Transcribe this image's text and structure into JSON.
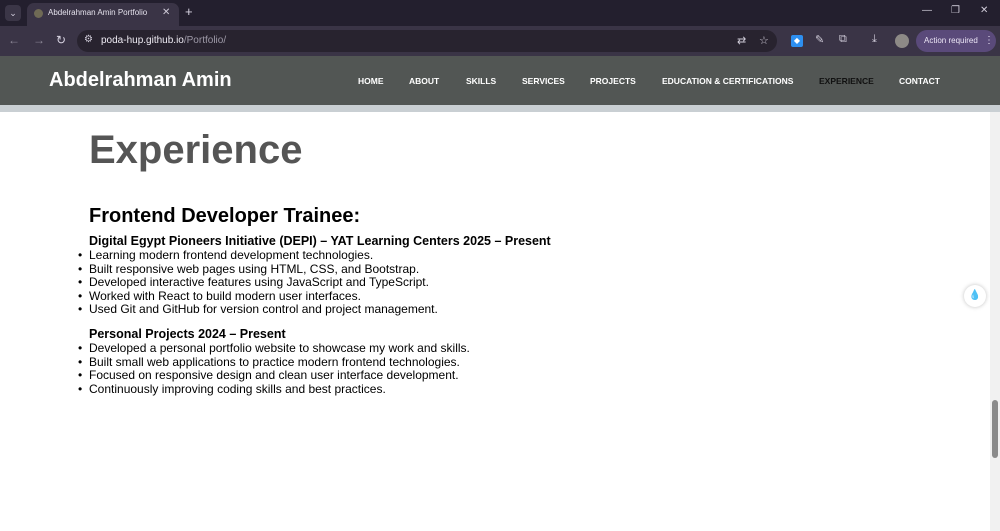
{
  "browser": {
    "tab_title": "Abdelrahman Amin Portfolio",
    "new_tab_icon": "plus-icon",
    "url_host": "poda-hup.github.io",
    "url_path": "/Portfolio/",
    "action_required": "Action required"
  },
  "site": {
    "brand": "Abdelrahman Amin",
    "nav": [
      "HOME",
      "ABOUT",
      "SKILLS",
      "SERVICES",
      "PROJECTS",
      "EDUCATION & CERTIFICATIONS",
      "EXPERIENCE",
      "CONTACT"
    ],
    "active_nav": "EXPERIENCE"
  },
  "content": {
    "section_title": "Experience",
    "job_title": "Frontend Developer Trainee:",
    "groups": [
      {
        "heading": "Digital Egypt Pioneers Initiative (DEPI) – YAT Learning Centers 2025 – Present",
        "items": [
          "Learning modern frontend development technologies.",
          "Built responsive web pages using HTML, CSS, and Bootstrap.",
          "Developed interactive features using JavaScript and TypeScript.",
          "Worked with React to build modern user interfaces.",
          "Used Git and GitHub for version control and project management."
        ]
      },
      {
        "heading": "Personal Projects 2024 – Present",
        "items": [
          "Developed a personal portfolio website to showcase my work and skills.",
          "Built small web applications to practice modern frontend technologies.",
          "Focused on responsive design and clean user interface development.",
          "Continuously improving coding skills and best practices."
        ]
      }
    ]
  },
  "colors": {
    "header_bg": "#525654",
    "title_gray": "#555555",
    "browser_dark": "#231f2e"
  }
}
